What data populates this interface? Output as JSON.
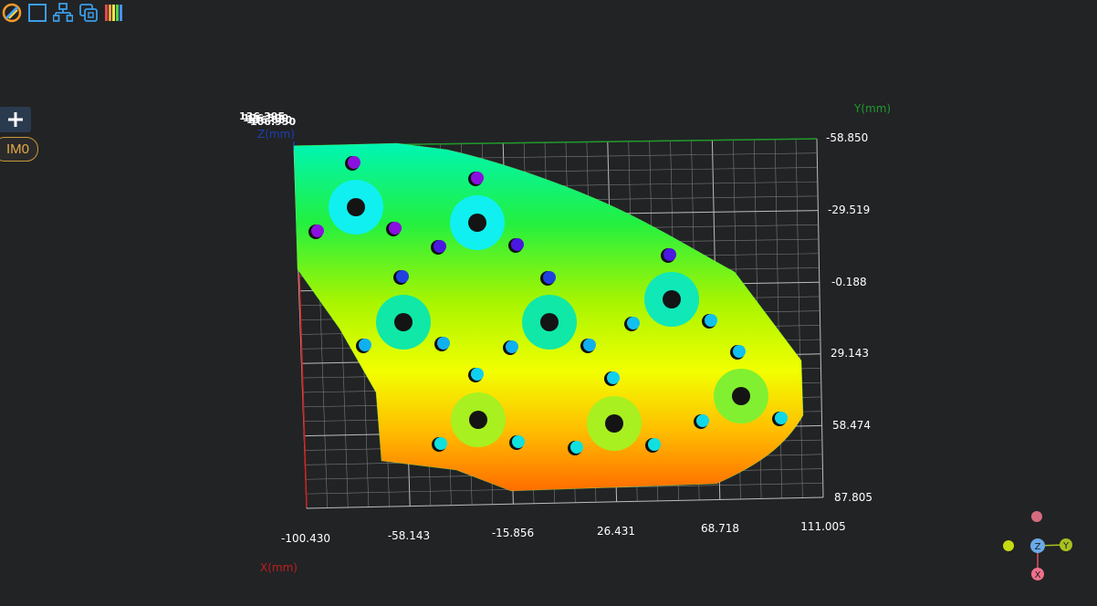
{
  "toolbar": {
    "buttons": [
      {
        "name": "color-palette-icon"
      },
      {
        "name": "frame-icon"
      },
      {
        "name": "hierarchy-icon"
      },
      {
        "name": "copy-view-icon"
      },
      {
        "name": "color-bars-icon"
      }
    ]
  },
  "left_panel": {
    "add_label": "+",
    "image_label": "IM0"
  },
  "axes": {
    "x_title": "X(mm)",
    "y_title": "Y(mm)",
    "z_title": "Z(mm)",
    "x_ticks": [
      "-100.430",
      "-58.143",
      "-15.856",
      "26.431",
      "68.718",
      "111.005"
    ],
    "y_ticks": [
      "-58.850",
      "-29.519",
      "-0.188",
      "29.143",
      "58.474",
      "87.805"
    ],
    "z_ticks": [
      "136.395",
      "126.500",
      "116.680",
      "106.950"
    ]
  },
  "gizmo": {
    "z": "Z",
    "y": "Y",
    "x": "X"
  },
  "colors": {
    "background": "#222325",
    "x_axis": "#d02020",
    "y_axis": "#1f9a2a",
    "z_axis": "#1f3fb0",
    "grid": "#9a9a9a"
  }
}
